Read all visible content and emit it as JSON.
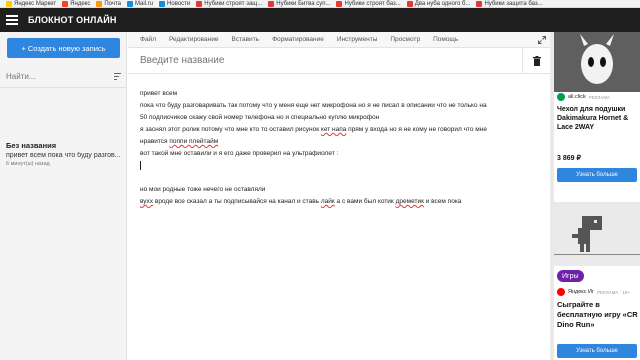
{
  "bookmarks": [
    {
      "label": "Яндекс Маркет",
      "color": "#ffcc00"
    },
    {
      "label": "Яндекс",
      "color": "#fc3f1d"
    },
    {
      "label": "Почта",
      "color": "#ff9900"
    },
    {
      "label": "Mail.ru",
      "color": "#168de2"
    },
    {
      "label": "Новости",
      "color": "#168de2"
    },
    {
      "label": "Нубики строят защ...",
      "color": "#e53935"
    },
    {
      "label": "Нубики Битва суп...",
      "color": "#e53935"
    },
    {
      "label": "Нубики строят баз...",
      "color": "#e53935"
    },
    {
      "label": "Два нуба одного б...",
      "color": "#e53935"
    },
    {
      "label": "Нубики защита баз...",
      "color": "#e53935"
    }
  ],
  "header": {
    "title": "БЛОКНОТ ОНЛАЙН"
  },
  "sidebar": {
    "new_button": "+ Создать новую запись",
    "search_placeholder": "Найти...",
    "notes": [
      {
        "title": "Без названия",
        "preview": "привет всем пока что буду разгов...",
        "time": "6 минут(ы) назад"
      }
    ]
  },
  "editor": {
    "menu": [
      "Файл",
      "Редактирование",
      "Вставить",
      "Форматирование",
      "Инструменты",
      "Просмотр",
      "Помощь"
    ],
    "title_placeholder": "Введите название",
    "lines": [
      "привет всем",
      "пока что буду разговаривать так потому что у меня еще нет микрофона но я не писал в описании что не только на",
      "50 подписчиков скажу свой номер телефона но и специально куплю микрофон",
      "я заснял этот ролик потому что мне кто то оставил рисунок ",
      "нравится ",
      "вот такой мне оставили и я его даже проверил на ультрафиолет :",
      "",
      "",
      "но мои родные тоже нечего не оставляли",
      " вроде все сказал а ты подписывайся на канал и ставь ",
      ""
    ],
    "line4": {
      "a": "я заснял этот ролик потому что мне кто то оставил рисунок ",
      "b": "кет напа",
      "c": " прям у входа но я не кому не говорил что мне"
    },
    "line5": {
      "a": "нравится ",
      "b": "поппи плейтайм"
    },
    "line10": {
      "a": "вухх",
      "b": " вроде все сказал а ты подписывайся на канал и ставь ",
      "c": "лайк",
      "d": " а с вами был котик ",
      "e": "дреметик",
      "f": " и всем пока"
    }
  },
  "ads": {
    "ad1": {
      "source": "ali.click",
      "tag": "РЕКЛАМА",
      "title": "Чехол для подушки Dakimakura Hornet & Lace 2WAY",
      "price": "3 869 ₽",
      "button": "Узнать больше"
    },
    "ad2": {
      "badge": "Игры",
      "source": "Яндекс Иг",
      "tag": "РЕКЛАМА · 18+",
      "title": "Сыграйте в бесплатную игру «CR Dino Run»",
      "button": "Узнать больше"
    }
  }
}
